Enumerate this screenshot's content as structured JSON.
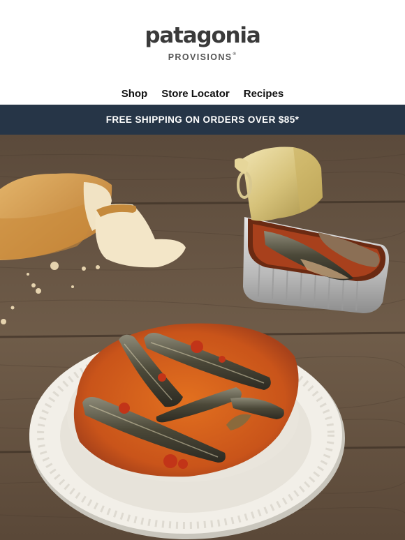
{
  "brand": {
    "logo_text": "patagonia",
    "sub_text": "PROVISIONS",
    "reg_mark": "®"
  },
  "nav": {
    "items": [
      {
        "label": "Shop"
      },
      {
        "label": "Store Locator"
      },
      {
        "label": "Recipes"
      }
    ]
  },
  "banner": {
    "text": "FREE SHIPPING ON ORDERS OVER $85*"
  },
  "colors": {
    "banner_bg": "#263547",
    "wood": "#6b5a48",
    "oil": "#d9631c"
  }
}
